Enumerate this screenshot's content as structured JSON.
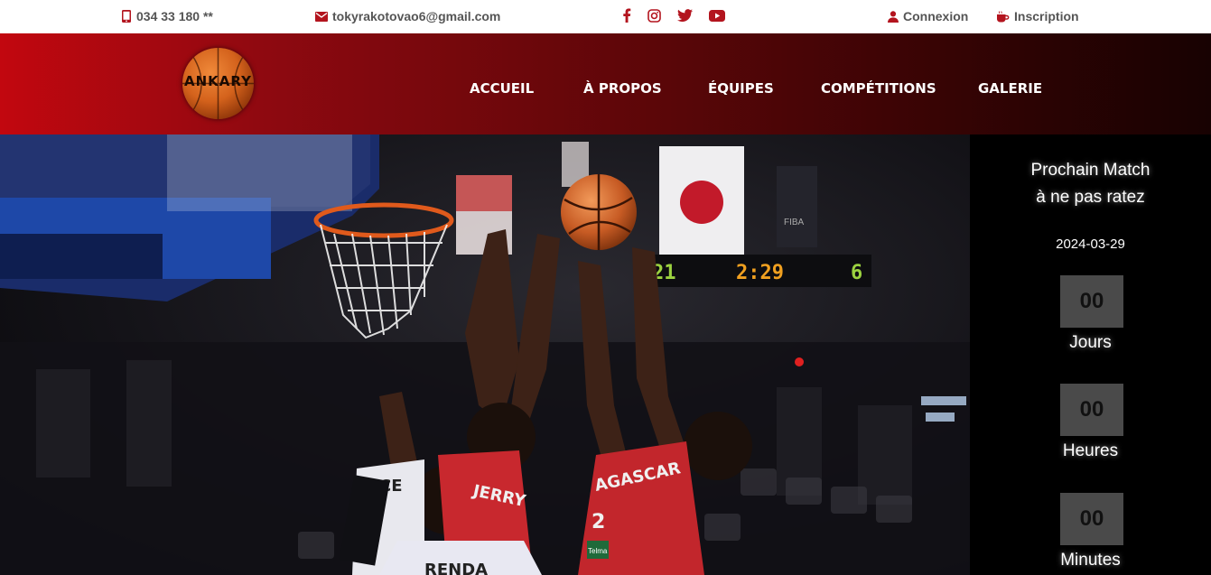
{
  "topbar": {
    "phone": "034 33 180 **",
    "email": "tokyrakotovao6@gmail.com",
    "social": [
      "facebook-icon",
      "instagram-icon",
      "twitter-icon",
      "youtube-icon"
    ],
    "login": "Connexion",
    "signup": "Inscription"
  },
  "brand": {
    "logo_text": "ANKARY"
  },
  "nav": {
    "items": [
      "ACCUEIL",
      "À PROPOS",
      "ÉQUIPES",
      "COMPÉTITIONS",
      "GALERIE"
    ]
  },
  "hero": {
    "scoreboard": {
      "home": "21",
      "clock": "2:29",
      "away": "6"
    },
    "banner": "FIBA",
    "jerseys": [
      "JERRY",
      "AGASCAR",
      "2",
      "RENDA",
      "CE",
      "Telma"
    ]
  },
  "next_match": {
    "title_line1": "Prochain Match",
    "title_line2": "à ne pas ratez",
    "date": "2024-03-29",
    "countdown": [
      {
        "value": "00",
        "label": "Jours"
      },
      {
        "value": "00",
        "label": "Heures"
      },
      {
        "value": "00",
        "label": "Minutes"
      }
    ]
  },
  "colors": {
    "accent": "#b3141e",
    "header_start": "#c2070f",
    "header_end": "#180202",
    "countdown_box": "#4a4a4a"
  }
}
